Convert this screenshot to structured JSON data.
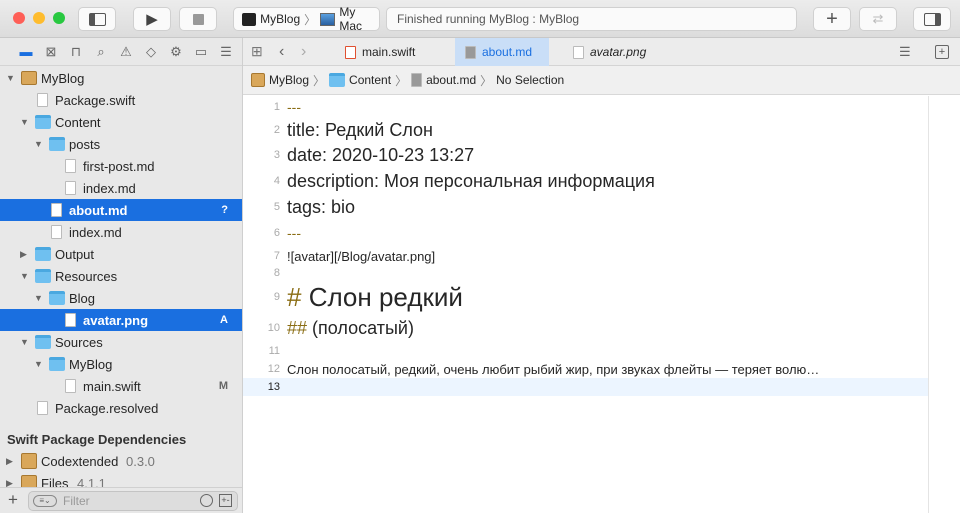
{
  "window": {
    "scheme": "MyBlog",
    "destination": "My Mac",
    "status": "Finished running MyBlog : MyBlog"
  },
  "toolbar": {
    "add_icon": "plus-icon",
    "swap_icon": "arrows-icon"
  },
  "navigator": {
    "icons": [
      "folder-icon",
      "source-control-icon",
      "hierarchy-icon",
      "search-icon",
      "warning-icon",
      "test-icon",
      "debug-icon",
      "breakpoint-icon",
      "report-icon"
    ],
    "tree": [
      {
        "label": "MyBlog",
        "level": 0,
        "type": "pkg",
        "expanded": true
      },
      {
        "label": "Package.swift",
        "level": 1,
        "type": "file"
      },
      {
        "label": "Content",
        "level": 1,
        "type": "folder",
        "expanded": true
      },
      {
        "label": "posts",
        "level": 2,
        "type": "folder",
        "expanded": true
      },
      {
        "label": "first-post.md",
        "level": 3,
        "type": "file"
      },
      {
        "label": "index.md",
        "level": 3,
        "type": "file"
      },
      {
        "label": "about.md",
        "level": 2,
        "type": "file",
        "selected": true,
        "badge": "?"
      },
      {
        "label": "index.md",
        "level": 2,
        "type": "file"
      },
      {
        "label": "Output",
        "level": 1,
        "type": "folder",
        "expanded": false
      },
      {
        "label": "Resources",
        "level": 1,
        "type": "folder",
        "expanded": true
      },
      {
        "label": "Blog",
        "level": 2,
        "type": "folder",
        "expanded": true
      },
      {
        "label": "avatar.png",
        "level": 3,
        "type": "file",
        "selected": true,
        "badge": "A"
      },
      {
        "label": "Sources",
        "level": 1,
        "type": "folder",
        "expanded": true
      },
      {
        "label": "MyBlog",
        "level": 2,
        "type": "folder",
        "expanded": true
      },
      {
        "label": "main.swift",
        "level": 3,
        "type": "file",
        "badge": "M"
      },
      {
        "label": "Package.resolved",
        "level": 1,
        "type": "file"
      }
    ],
    "dependencies_header": "Swift Package Dependencies",
    "dependencies": [
      {
        "name": "Codextended",
        "version": "0.3.0"
      },
      {
        "name": "Files",
        "version": "4.1.1"
      }
    ],
    "filter_placeholder": "Filter"
  },
  "tabs": [
    {
      "label": "main.swift"
    },
    {
      "label": "about.md",
      "active": true
    },
    {
      "label": "avatar.png"
    }
  ],
  "jumpbar": [
    "MyBlog",
    "Content",
    "about.md",
    "No Selection"
  ],
  "editor": {
    "current_line": 13,
    "lines": [
      {
        "n": "1",
        "mark": "---",
        "text": ""
      },
      {
        "n": "2",
        "mark": "",
        "text": "title: Редкий Слон"
      },
      {
        "n": "3",
        "mark": "",
        "text": "date: 2020-10-23 13:27"
      },
      {
        "n": "4",
        "mark": "",
        "text": "description: Моя персональная информация"
      },
      {
        "n": "5",
        "mark": "",
        "text": "tags: bio"
      },
      {
        "n": "6",
        "mark": "---",
        "text": ""
      },
      {
        "n": "7",
        "mark": "",
        "text": "![avatar][/Blog/avatar.png]"
      },
      {
        "n": "8",
        "mark": "",
        "text": ""
      },
      {
        "n": "9",
        "mark": "#",
        "text": " Слон редкий"
      },
      {
        "n": "10",
        "mark": "##",
        "text": " (полосатый)"
      },
      {
        "n": "11",
        "mark": "",
        "text": ""
      },
      {
        "n": "12",
        "mark": "",
        "text": "Слон полосатый, редкий, очень любит рыбий жир, при звуках флейты — теряет волю…"
      },
      {
        "n": "13",
        "mark": "",
        "text": ""
      }
    ]
  },
  "colors": {
    "accent": "#1a6fe0",
    "markdown_marker": "#8a6d14"
  }
}
